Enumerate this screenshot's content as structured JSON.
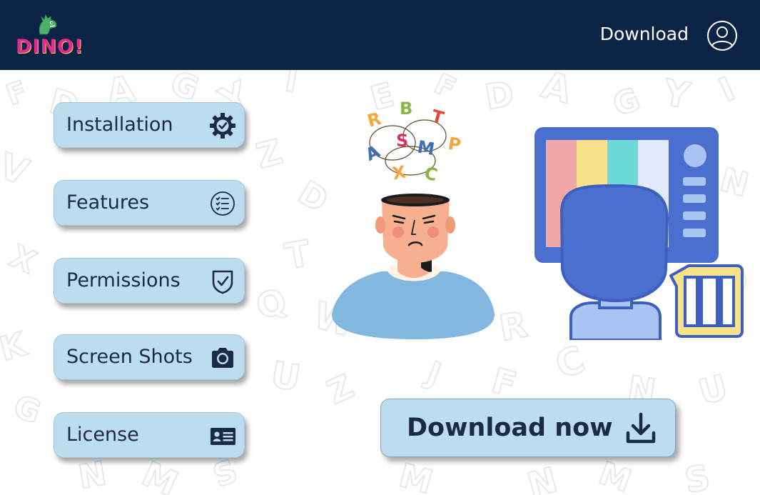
{
  "header": {
    "logo_text": "DINO!",
    "download_label": "Download",
    "icons": {
      "logo": "dino-icon",
      "account": "user-circle-icon"
    },
    "colors": {
      "background": "#0b2445",
      "logo": "#e12c8d",
      "text": "#ffffff"
    }
  },
  "sidebar": {
    "items": [
      {
        "label": "Installation",
        "icon": "gear-check-icon"
      },
      {
        "label": "Features",
        "icon": "checklist-icon"
      },
      {
        "label": "Permissions",
        "icon": "shield-check-icon"
      },
      {
        "label": "Screen Shots",
        "icon": "camera-icon"
      },
      {
        "label": "License",
        "icon": "id-card-icon"
      }
    ],
    "colors": {
      "button": "#bcdcef",
      "text": "#1b2a47"
    }
  },
  "illustration_letters": [
    "R",
    "B",
    "T",
    "A",
    "S",
    "M",
    "P",
    "X",
    "C"
  ],
  "main": {
    "download_now_label": "Download now",
    "download_icon": "download-icon"
  }
}
